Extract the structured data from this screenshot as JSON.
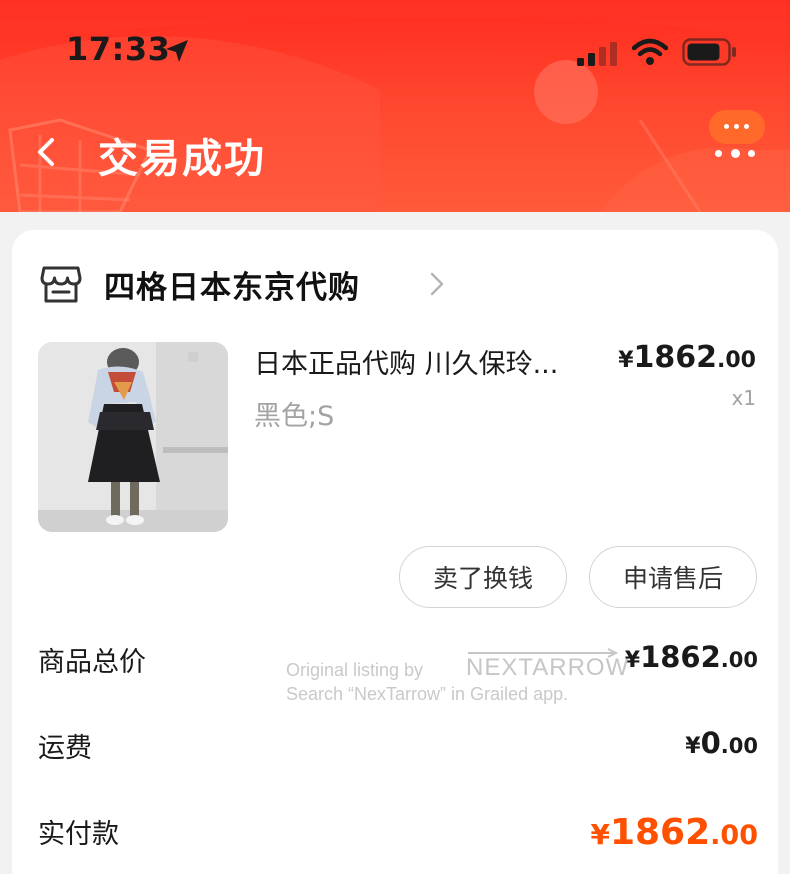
{
  "status_bar": {
    "time": "17:33"
  },
  "nav": {
    "title": "交易成功"
  },
  "shop": {
    "name": "四格日本东京代购"
  },
  "product": {
    "title": "日本正品代购 川久保玲...",
    "spec": "黑色;S",
    "price_symbol": "¥",
    "price_int": "1862",
    "price_dec": ".00",
    "quantity": "x1"
  },
  "actions": {
    "sell_label": "卖了换钱",
    "aftersale_label": "申请售后"
  },
  "summary": {
    "goods_total_label": "商品总价",
    "goods_total_symbol": "¥",
    "goods_total_int": "1862",
    "goods_total_dec": ".00",
    "shipping_label": "运费",
    "shipping_symbol": "¥",
    "shipping_int": "0",
    "shipping_dec": ".00",
    "paid_label": "实付款",
    "paid_symbol": "¥",
    "paid_int": "1862",
    "paid_dec": ".00"
  },
  "watermark": {
    "line1": "Original listing by",
    "logo": "NEXTARROW",
    "line2": "Search “NexTarrow” in Grailed app."
  },
  "colors": {
    "header_red": "#ff2b1f",
    "accent_orange": "#ff5000",
    "badge_orange": "#ff6a2a"
  },
  "icons": {
    "back": "chevron-left-icon",
    "more": "more-dots-icon",
    "message": "message-bubble-icon",
    "shop": "shop-icon",
    "chevron": "chevron-right-icon",
    "location": "location-arrow-icon",
    "signal": "signal-icon",
    "wifi": "wifi-icon",
    "battery": "battery-icon"
  }
}
